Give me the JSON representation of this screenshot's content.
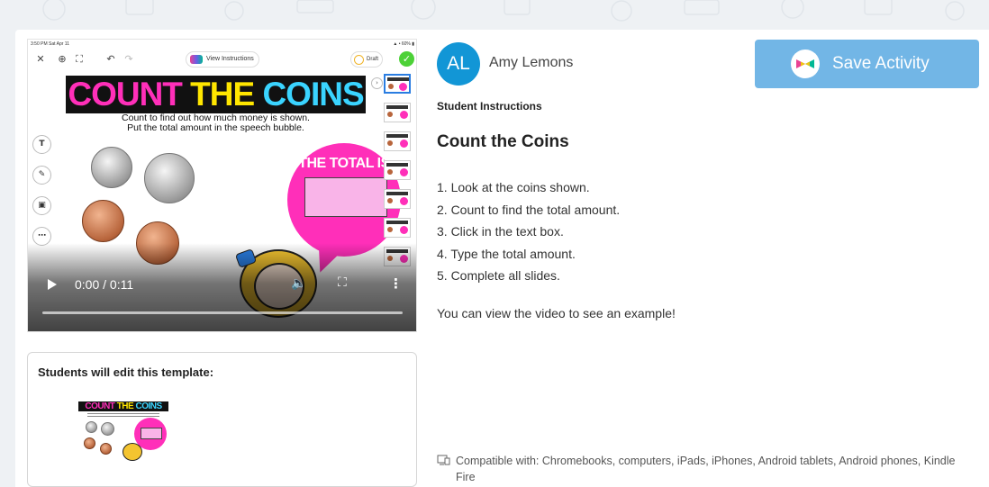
{
  "video": {
    "status_time": "3:50 PM  Sat Apr 11",
    "status_right": "▲ • 60% ▮",
    "toolbar": {
      "close_glyph": "✕",
      "zoom_glyph": "⊕",
      "expand_glyph": "⛶",
      "undo_glyph": "↶",
      "redo_glyph": "↷",
      "view_instructions_label": "View Instructions",
      "draft_label": "Draft",
      "done_glyph": "✓"
    },
    "tools": [
      "T",
      "✎",
      "▣",
      "⋯"
    ],
    "slide": {
      "title_part1": "COUNT ",
      "title_part2": "THE ",
      "title_part3": "COINS",
      "subtitle_line1": "Count to find out how much money is shown.",
      "subtitle_line2": "Put the total amount in the speech bubble.",
      "bubble_title": "THE TOTAL IS"
    },
    "side_arrow_glyph": "›",
    "player": {
      "time": "0:00 / 0:11",
      "volume_glyph": "🔈",
      "fullscreen_glyph": "⛶",
      "more_glyph": "⋮",
      "progress": 0
    }
  },
  "template": {
    "label": "Students will edit this template:",
    "title_part1": "COUNT ",
    "title_part2": "THE ",
    "title_part3": "COINS"
  },
  "author": {
    "initials": "AL",
    "name": "Amy Lemons",
    "avatar_color": "#1296d6"
  },
  "save_button": {
    "label": "Save Activity",
    "color": "#72b6e6"
  },
  "instructions": {
    "label": "Student Instructions",
    "title": "Count the Coins",
    "steps": [
      "1. Look at the coins shown.",
      "2. Count to find the total amount.",
      "3. Click in the text box.",
      "4. Type the total amount.",
      "5. Complete all slides."
    ],
    "note": "You can view the video to see an example!"
  },
  "compatibility": {
    "text": "Compatible with: Chromebooks, computers, iPads, iPhones, Android tablets, Android phones, Kindle Fire"
  }
}
